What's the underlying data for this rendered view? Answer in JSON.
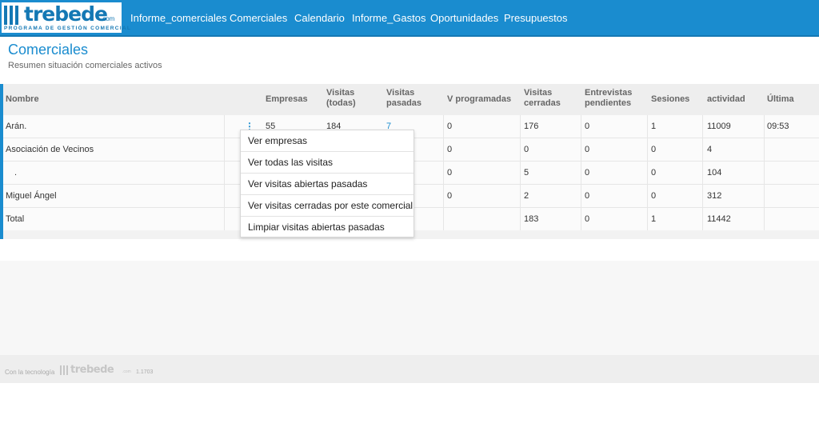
{
  "brand": {
    "name": "trebede",
    "domain": ".com",
    "tagline": "PROGRAMA DE GESTIÓN COMERCIAL"
  },
  "nav": {
    "items": [
      {
        "label": "Informe_comerciales"
      },
      {
        "label": "Comerciales"
      },
      {
        "label": "Calendario"
      },
      {
        "label": "Informe_Gastos"
      },
      {
        "label": "Oportunidades"
      },
      {
        "label": "Presupuestos"
      }
    ]
  },
  "page": {
    "title": "Comerciales",
    "subtitle": "Resumen situación comerciales activos"
  },
  "table": {
    "headers": [
      {
        "label": "Nombre"
      },
      {
        "label": "Empresas"
      },
      {
        "line1": "Visitas",
        "line2": "(todas)"
      },
      {
        "line1": "Visitas",
        "line2": "pasadas"
      },
      {
        "label": "V programadas"
      },
      {
        "line1": "Visitas",
        "line2": "cerradas"
      },
      {
        "line1": "Entrevistas",
        "line2": "pendientes"
      },
      {
        "label": "Sesiones"
      },
      {
        "label": "actividad"
      },
      {
        "label": "Última"
      }
    ],
    "rows": [
      {
        "nombre": "Arán.",
        "empresas": "55",
        "visitas_todas": "184",
        "visitas_pasadas": "7",
        "v_programadas": "0",
        "visitas_cerradas": "176",
        "entrevistas": "0",
        "sesiones": "1",
        "actividad": "11009",
        "ultima": "09:53"
      },
      {
        "nombre": "Asociación de Vecinos",
        "v_programadas": "0",
        "visitas_cerradas": "0",
        "entrevistas": "0",
        "sesiones": "0",
        "actividad": "4"
      },
      {
        "nombre": ".",
        "v_programadas": "0",
        "visitas_cerradas": "5",
        "entrevistas": "0",
        "sesiones": "0",
        "actividad": "104"
      },
      {
        "nombre": "Miguel Ángel",
        "v_programadas": "0",
        "visitas_cerradas": "2",
        "entrevistas": "0",
        "sesiones": "0",
        "actividad": "312"
      },
      {
        "nombre": "Total",
        "visitas_cerradas": "183",
        "entrevistas": "0",
        "sesiones": "1",
        "actividad": "11442"
      }
    ]
  },
  "row_menu": {
    "trigger_icon": "kebab-vertical-icon",
    "items": [
      {
        "label": "Ver empresas"
      },
      {
        "label": "Ver todas las visitas"
      },
      {
        "label": "Ver visitas abiertas pasadas"
      },
      {
        "label": "Ver visitas cerradas por este comercial"
      },
      {
        "label": "Limpiar visitas abiertas pasadas"
      }
    ]
  },
  "footer": {
    "text": "Con la tecnología",
    "brand": "trebede",
    "domain": ".com",
    "version": "1.1703"
  },
  "colors": {
    "primary": "#1a8ccf",
    "header_text": "#666666",
    "body_text": "#333333"
  }
}
